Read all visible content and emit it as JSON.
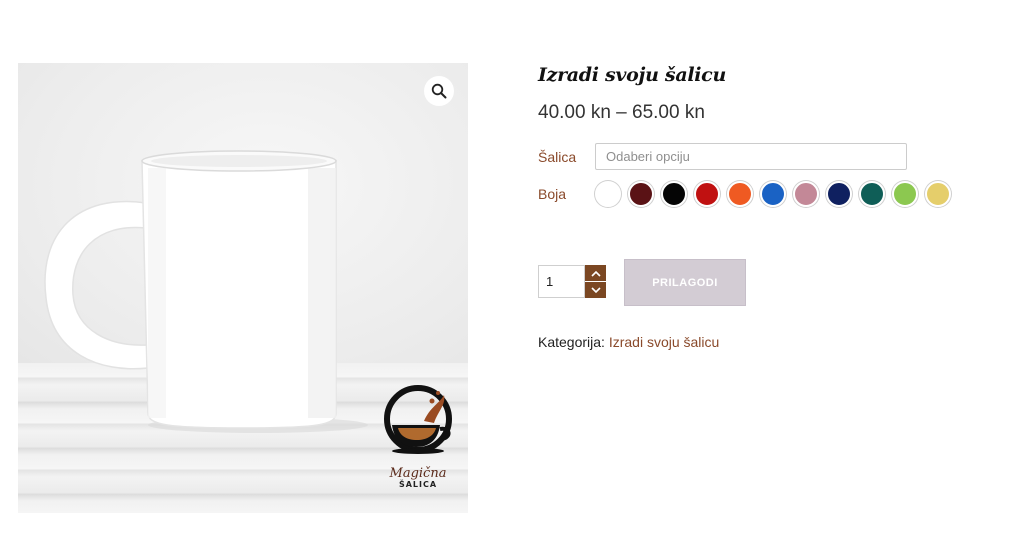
{
  "product": {
    "title": "Izradi svoju šalicu",
    "price": "40.00 kn – 65.00 kn"
  },
  "variations": {
    "salica": {
      "label": "Šalica",
      "placeholder": "Odaberi opciju"
    },
    "boja": {
      "label": "Boja",
      "swatches": [
        "#ffffff",
        "#5a1215",
        "#050505",
        "#c01111",
        "#ef5a22",
        "#1a62c4",
        "#c38897",
        "#0f2060",
        "#0f5e57",
        "#8cc850",
        "#e5ce6b"
      ]
    }
  },
  "cart": {
    "quantity": "1",
    "button_label": "PRILAGODI"
  },
  "meta": {
    "category_label": "Kategorija:",
    "category_value": "Izradi svoju šalicu"
  },
  "logo": {
    "script_text": "Magična",
    "caps_text": "ŠALICA"
  },
  "colors": {
    "accent_brown": "#7b4722",
    "label_brown": "#8a4a2b",
    "button_disabled": "#d3ccd4"
  },
  "icons": [
    "zoom-icon",
    "chevron-up-icon",
    "chevron-down-icon"
  ]
}
